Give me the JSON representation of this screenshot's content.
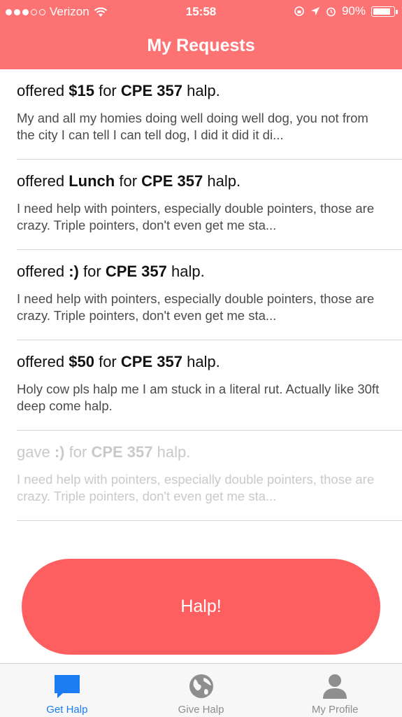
{
  "status_bar": {
    "carrier": "Verizon",
    "time": "15:58",
    "battery_percent": "90%",
    "battery_level": 0.9,
    "signal_bars_filled": 3,
    "signal_bars_total": 5
  },
  "nav": {
    "title": "My Requests"
  },
  "requests": [
    {
      "verb": "offered",
      "offer": "$15",
      "mid": "for",
      "course": "CPE 357",
      "end": "halp.",
      "body": "My and all my homies doing well doing well dog, you not from the city I can tell I can tell dog, I did it did it di...",
      "faded": false
    },
    {
      "verb": "offered",
      "offer": "Lunch",
      "mid": "for",
      "course": "CPE 357",
      "end": "halp.",
      "body": "I need help with pointers, especially double pointers, those are crazy. Triple pointers, don't even get me sta...",
      "faded": false
    },
    {
      "verb": "offered",
      "offer": ":)",
      "mid": "for",
      "course": "CPE 357",
      "end": "halp.",
      "body": "I need help with pointers, especially double pointers, those are crazy. Triple pointers, don't even get me sta...",
      "faded": false
    },
    {
      "verb": "offered",
      "offer": "$50",
      "mid": "for",
      "course": "CPE 357",
      "end": "halp.",
      "body": "Holy cow pls halp me I am stuck in a literal rut. Actually like 30ft deep come halp.",
      "faded": false
    },
    {
      "verb": "gave",
      "offer": ":)",
      "mid": "for",
      "course": "CPE 357",
      "end": "halp.",
      "body": "I need help with pointers, especially double pointers, those are crazy. Triple pointers, don't even get me sta...",
      "faded": true
    }
  ],
  "action_button": {
    "label": "Halp!"
  },
  "tabs": [
    {
      "label": "Get Halp",
      "icon": "chat-bubble-icon",
      "active": true
    },
    {
      "label": "Give Halp",
      "icon": "globe-icon",
      "active": false
    },
    {
      "label": "My Profile",
      "icon": "person-icon",
      "active": false
    }
  ],
  "colors": {
    "brand": "#fd7374",
    "button": "#fd5f60",
    "tab_active": "#1b7cf4",
    "tab_inactive": "#8e8e8e"
  }
}
